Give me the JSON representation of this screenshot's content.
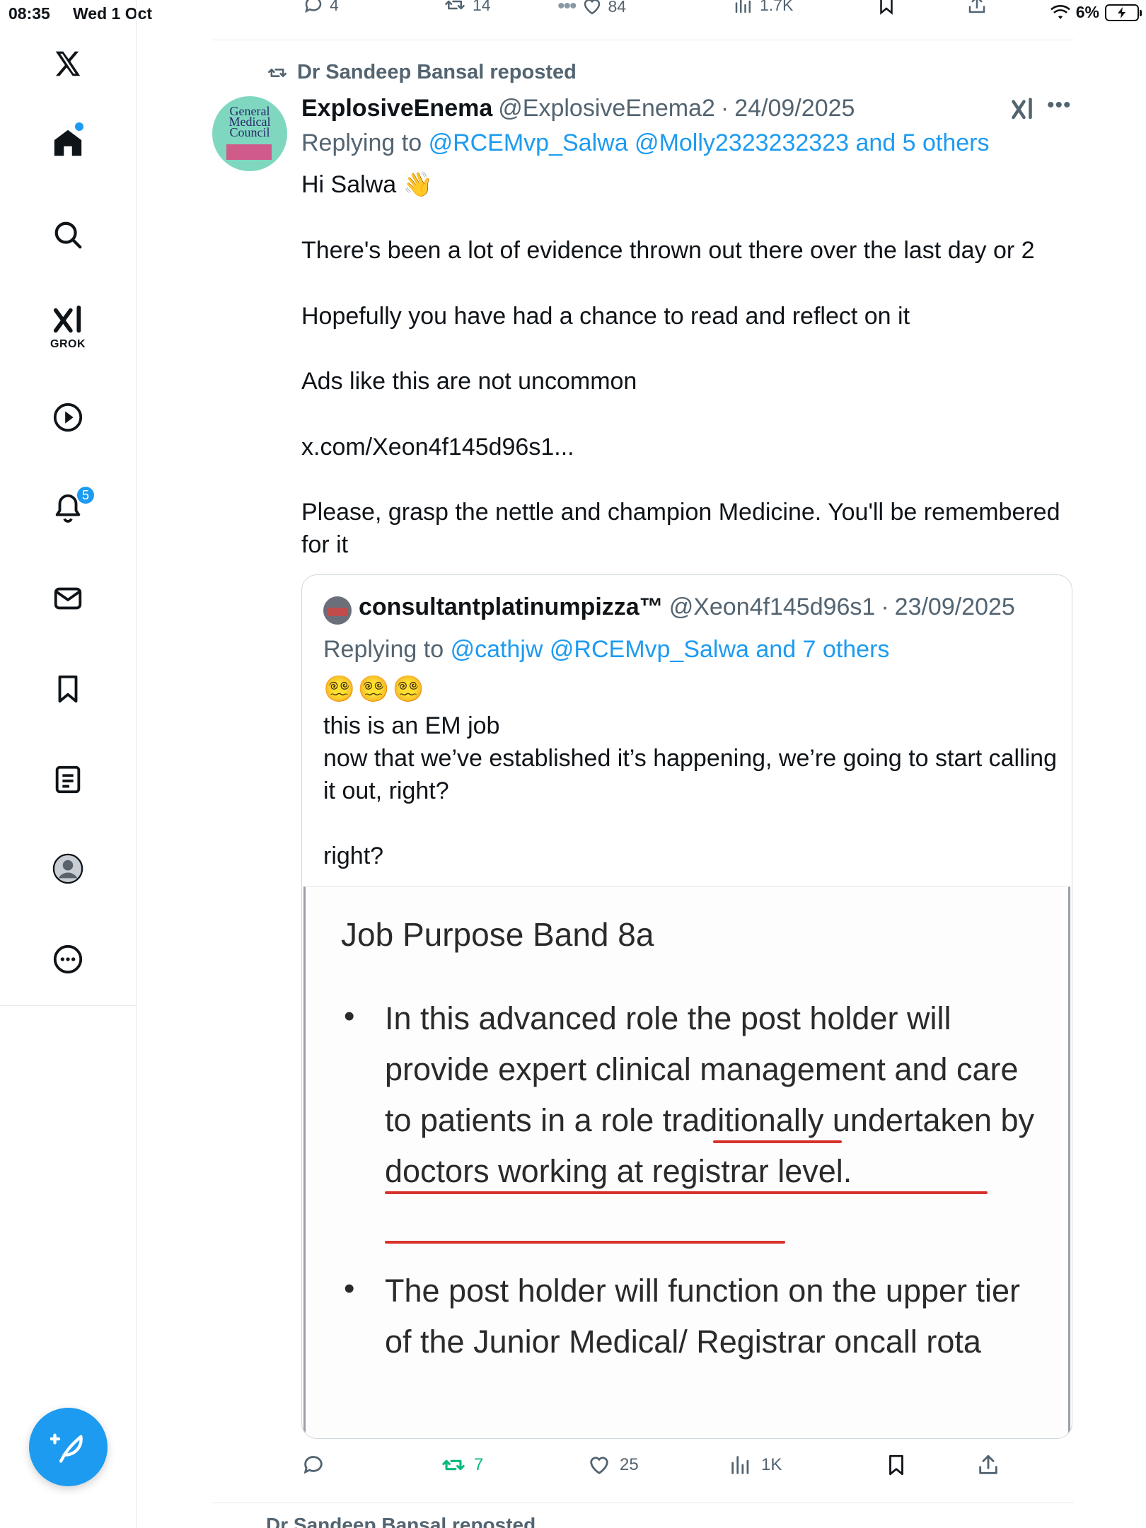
{
  "status_bar": {
    "time": "08:35",
    "date": "Wed 1 Oct",
    "battery": "6%"
  },
  "sidebar": {
    "grok_label": "GROK",
    "notification_count": "5"
  },
  "prev_tweet_actions": {
    "replies": "4",
    "reposts": "14",
    "likes": "84",
    "views": "1.7K"
  },
  "tweet": {
    "reposted_by": "Dr Sandeep Bansal reposted",
    "avatar_text": "General Medical Council",
    "author_name": "ExplosiveEnema",
    "author_handle": "@ExplosiveEnema2",
    "separator": "·",
    "date": "24/09/2025",
    "replying_to_label": "Replying to",
    "replying_to_links": "@RCEMvp_Salwa @Molly2323232323 and 5 others",
    "greeting": "Hi Salwa 👋",
    "para1": "There's been a lot of evidence thrown out there over the last day or 2",
    "para2": "Hopefully you have had a chance to read and reflect on it",
    "para3": "Ads like this are not uncommon",
    "link": "x.com/Xeon4f145d96s1...",
    "para4": "Please, grasp the nettle and champion Medicine. You'll be remembered for it"
  },
  "quote": {
    "author_name": "consultantplatinumpizza™",
    "author_handle": "@Xeon4f145d96s1",
    "separator": "·",
    "date": "23/09/2025",
    "replying_to_label": "Replying to",
    "replying_to_links": "@cathjw @RCEMvp_Salwa and 7 others",
    "emojis": "😵‍💫😵‍💫😵‍💫",
    "line1": "this is an EM job",
    "line2": "now that we’ve established it’s happening, we’re going to start calling it out, right?",
    "line3": "right?",
    "image": {
      "title": "Job Purpose Band 8a",
      "bullet1": "In this advanced role the post holder will provide expert clinical management and care to patients in a role traditionally undertaken by doctors working at registrar level.",
      "bullet2": "The post holder will function on the upper tier of the Junior Medical/ Registrar oncall rota"
    }
  },
  "actions": {
    "replies": "",
    "reposts": "7",
    "likes": "25",
    "views": "1K"
  },
  "next_item": {
    "text": "Dr Sandeep Bansal reposted"
  },
  "colors": {
    "accent": "#1d9bf0",
    "repost_active": "#00ba7c",
    "muted": "#536471",
    "underline": "#d8332b"
  }
}
